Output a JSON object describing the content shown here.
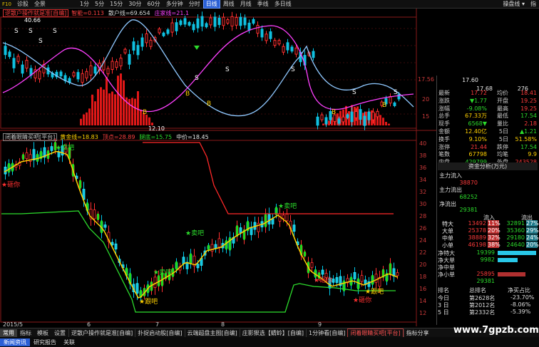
{
  "topbar": {
    "app_label": "F10",
    "menu": [
      "诊股",
      "全景"
    ],
    "periods": [
      "1分",
      "5分",
      "15分",
      "30分",
      "60分",
      "多分钟",
      "分时",
      "日线",
      "周线",
      "月线",
      "季线",
      "多日线"
    ],
    "active_period": "日线",
    "drop": [
      "操盘线",
      "指"
    ],
    "more": "▾"
  },
  "main_panel": {
    "name": "逆散户操作就是准[自编]",
    "legend": [
      {
        "text": "智能=0.113",
        "color": "#ff4040"
      },
      {
        "text": "散户线=69.654",
        "color": "#d8d8d8"
      },
      {
        "text": "庄家线=21.1",
        "color": "#ff40ff"
      }
    ],
    "labels": {
      "high": "40.66",
      "low": "12.10"
    },
    "right_axis": [
      "17.56",
      "20",
      "15"
    ],
    "right_top_nums": [
      "5",
      "17.68",
      "276",
      "17.60"
    ]
  },
  "sub_panel": {
    "name": "闭着眼睛买吧[平台]",
    "legend": [
      {
        "text": "黄金线=18.83",
        "color": "#ffd000"
      },
      {
        "text": "顶点=28.89",
        "color": "#ff4040"
      },
      {
        "text": "腿底=15.75",
        "color": "#2cdc2c"
      },
      {
        "text": "中价=18.45",
        "color": "#e8e8e8"
      }
    ],
    "right_axis": [
      "40",
      "38",
      "36",
      "34",
      "32",
      "30",
      "28",
      "26",
      "24",
      "22",
      "20",
      "18",
      "16",
      "14",
      "12"
    ],
    "x_labels": [
      "2015/5",
      "6",
      "7",
      "8",
      "9"
    ],
    "signals": {
      "sell": "卖吧",
      "follow": "跟吧",
      "stop": "砸你"
    }
  },
  "quote": {
    "rows": [
      {
        "l1": "最新",
        "v1": "17.72",
        "c1": "red",
        "l2": "均价",
        "v2": "18.41",
        "c2": "red"
      },
      {
        "l1": "涨跌",
        "v1": "▼1.77",
        "c1": "green",
        "l2": "开盘",
        "v2": "19.25",
        "c2": "red"
      },
      {
        "l1": "涨幅",
        "v1": "-9.08%",
        "c1": "green",
        "l2": "最高",
        "v2": "19.25",
        "c2": "red"
      },
      {
        "l1": "总手",
        "v1": "67.33万",
        "c1": "yellow",
        "l2": "最低",
        "v2": "17.54",
        "c2": "green"
      },
      {
        "l1": "现手",
        "v1": "6568▼",
        "c1": "green",
        "l2": "量比",
        "v2": "2.18",
        "c2": "red"
      },
      {
        "l1": "金额",
        "v1": "12.40亿",
        "c1": "yellow",
        "l2": "5日",
        "v2": "▲1.21",
        "c2": "green"
      },
      {
        "l1": "换手",
        "v1": "9.10%",
        "c1": "yellow",
        "l2": "5日",
        "v2": "51.58%",
        "c2": "yellow"
      },
      {
        "l1": "涨停",
        "v1": "21.44",
        "c1": "red",
        "l2": "跌停",
        "v2": "17.54",
        "c2": "green"
      },
      {
        "l1": "笔数",
        "v1": "67798",
        "c1": "yellow",
        "l2": "均笔",
        "v2": "9.9",
        "c2": "yellow"
      },
      {
        "l1": "内盘",
        "v1": "429799",
        "c1": "green",
        "l2": "外盘",
        "v2": "243528",
        "c2": "red"
      }
    ]
  },
  "fund": {
    "title": "资金分析(万元)",
    "inflow_label": "主力流入",
    "inflow": "38870",
    "outflow_label": "主力流出",
    "outflow": "68252",
    "net_label": "净流出",
    "net": "29381",
    "col_in": "流入",
    "col_out": "流出",
    "rows": [
      {
        "label": "特大",
        "in": "13492",
        "pin": "11%",
        "out": "32891",
        "pout": "27%"
      },
      {
        "label": "大单",
        "in": "25378",
        "pin": "20%",
        "out": "35360",
        "pout": "29%"
      },
      {
        "label": "中单",
        "in": "38889",
        "pin": "32%",
        "out": "29180",
        "pout": "24%"
      },
      {
        "label": "小单",
        "in": "46198",
        "pin": "38%",
        "out": "24640",
        "pout": "20%"
      }
    ],
    "net_rows": [
      {
        "label": "净特大",
        "value": "19399",
        "pct": 1.0,
        "color": "#29c7e8"
      },
      {
        "label": "净大单",
        "value": "9982",
        "pct": 0.51,
        "color": "#29c7e8"
      },
      {
        "label": "净中单",
        "value": "",
        "pct": 0.0,
        "color": "#29c7e8"
      },
      {
        "label": "净小单",
        "value": "25895",
        "pct": 0.72,
        "color": "#b03030"
      }
    ],
    "net_total": "29381",
    "pie": [
      {
        "share": 0.11,
        "color": "#b02020"
      },
      {
        "share": 0.2,
        "color": "#d84040"
      },
      {
        "share": 0.32,
        "color": "#ff6060"
      },
      {
        "share": 0.37,
        "color": "#ffaaaa"
      },
      {
        "share": 0.27,
        "color": "#1a8fa8"
      },
      {
        "share": 0.29,
        "color": "#23b7d0"
      },
      {
        "share": 0.24,
        "color": "#40d0e0"
      },
      {
        "share": 0.2,
        "color": "#80e6f0"
      }
    ]
  },
  "rank": {
    "headers": [
      "排名",
      "总排名",
      "净买占比"
    ],
    "rows": [
      {
        "label": "今日",
        "rank": "第2628名",
        "pct": "-23.70%"
      },
      {
        "label": "3 日",
        "rank": "第2012名",
        "pct": "-8.06%"
      },
      {
        "label": "5 日",
        "rank": "第2332名",
        "pct": "-5.39%"
      }
    ]
  },
  "bottom_tabs": {
    "tabs": [
      "常用",
      "指标",
      "模板",
      "设置"
    ],
    "active_tab": "常用",
    "templates": [
      "逆散户操作就是准[自编]",
      "扑捉启动股[自编]",
      "云端超盘主图[自编]",
      "庄影狠选【蜻蛉】[自编]",
      "1分钟看[自编]",
      "闭着眼睛买吧[平台]",
      "指标分享"
    ],
    "highlight_template": "闭着眼睛买吧[平台]",
    "right_label": "日线"
  },
  "status": {
    "items": [
      "新闻资讯",
      "研究报告",
      "关联"
    ],
    "active": "新闻资讯"
  },
  "watermark": "www.7gpzb.com"
}
